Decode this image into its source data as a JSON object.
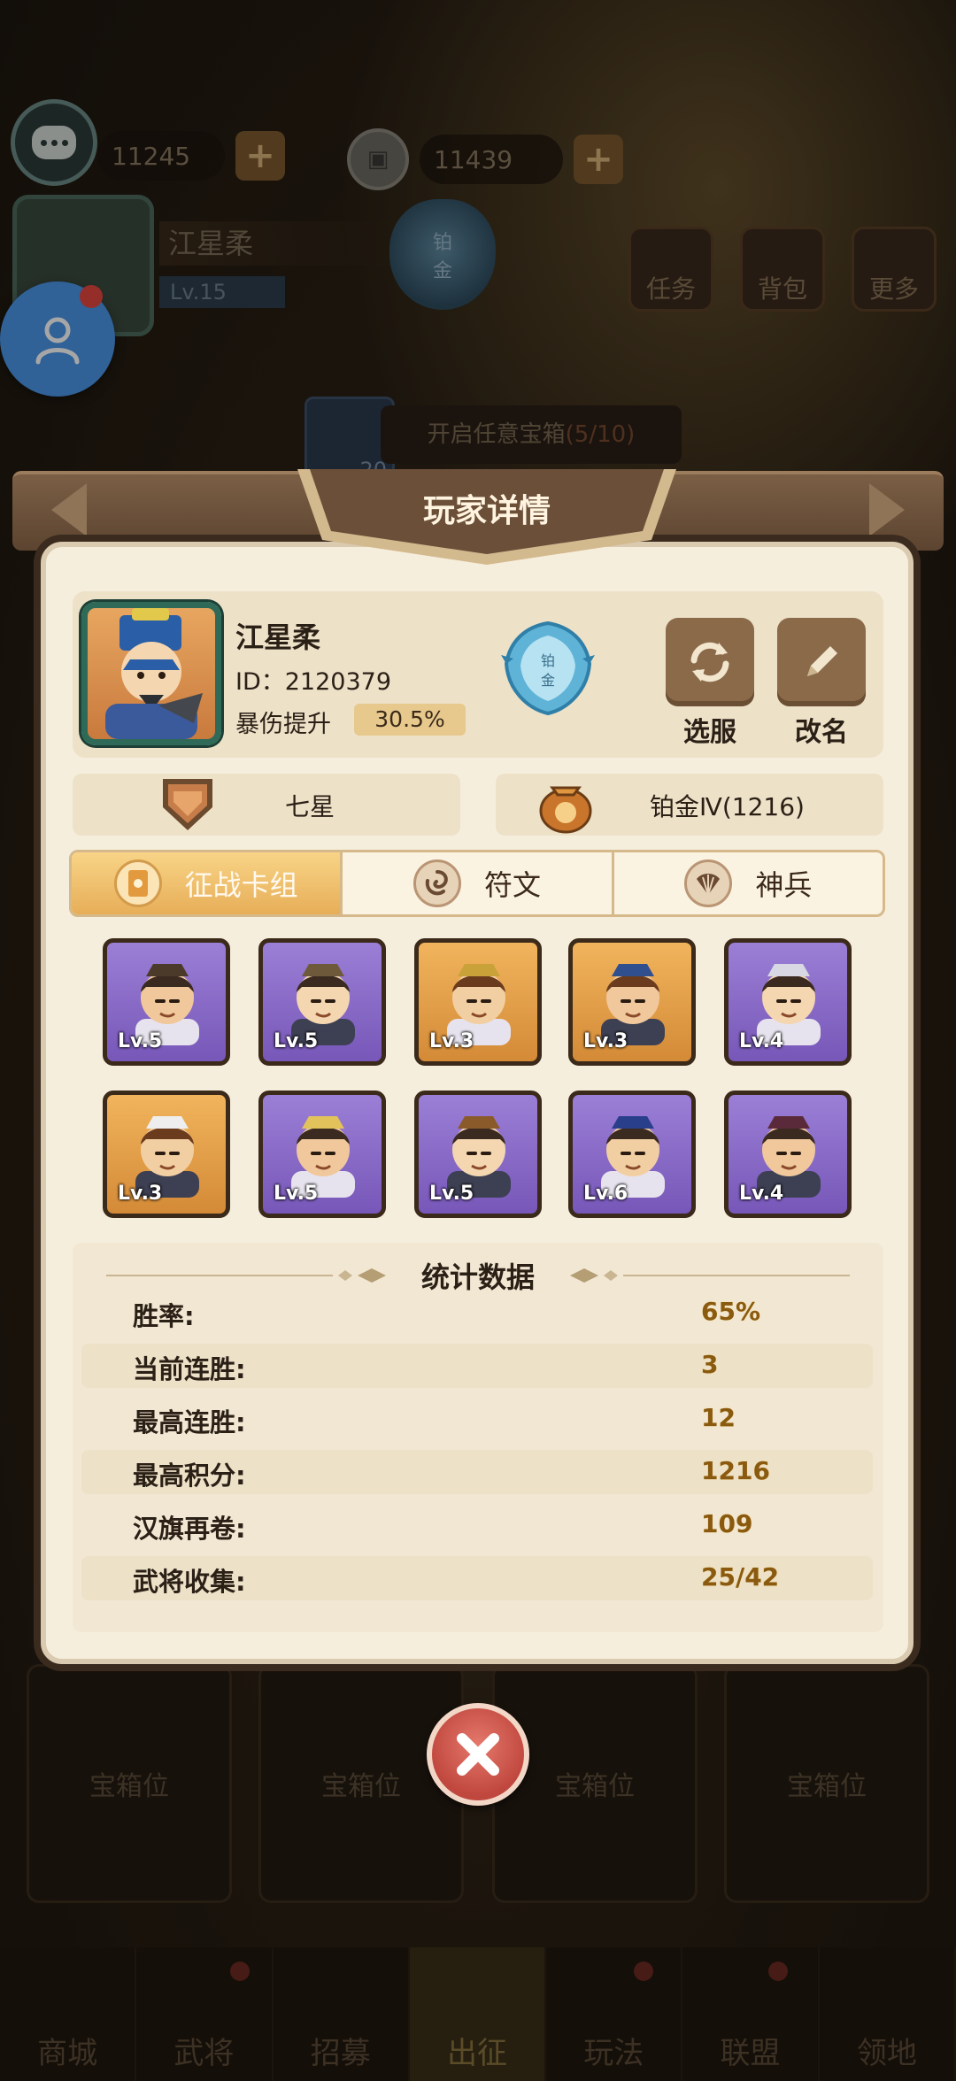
{
  "top_bar": {
    "currency1": "11245",
    "currency2": "11439"
  },
  "background": {
    "player_name": "江星柔",
    "player_level": "Lv.15",
    "rank_badge_chars": [
      "铂",
      "金"
    ],
    "menu": [
      "任务",
      "背包",
      "更多"
    ],
    "chest_count": "20",
    "chest_task": "开启任意宝箱",
    "chest_progress": "(5/10)",
    "chest_slots": [
      "宝箱位",
      "宝箱位",
      "宝箱位",
      "宝箱位"
    ],
    "bottom_nav": [
      "商城",
      "武将",
      "招募",
      "出征",
      "玩法",
      "联盟",
      "领地"
    ]
  },
  "modal": {
    "title": "玩家详情",
    "player": {
      "name": "江星柔",
      "id": "ID：2120379",
      "crit_label": "暴伤提升",
      "crit_value": "30.5%",
      "rank_badge_chars": [
        "铂",
        "金"
      ]
    },
    "actions": {
      "server": "选服",
      "rename": "改名"
    },
    "tiers": {
      "star": "七星",
      "rank": "铂金Ⅳ(1216)"
    },
    "tabs": [
      "征战卡组",
      "符文",
      "神兵"
    ],
    "active_tab": 0,
    "deck": [
      {
        "level": "Lv.5",
        "rarity": "purple"
      },
      {
        "level": "Lv.5",
        "rarity": "purple"
      },
      {
        "level": "Lv.3",
        "rarity": "gold"
      },
      {
        "level": "Lv.3",
        "rarity": "gold"
      },
      {
        "level": "Lv.4",
        "rarity": "purple"
      },
      {
        "level": "Lv.3",
        "rarity": "gold"
      },
      {
        "level": "Lv.5",
        "rarity": "purple"
      },
      {
        "level": "Lv.5",
        "rarity": "purple"
      },
      {
        "level": "Lv.6",
        "rarity": "purple"
      },
      {
        "level": "Lv.4",
        "rarity": "purple"
      }
    ],
    "stats_title": "统计数据",
    "stats": [
      {
        "label": "胜率:",
        "value": "65%"
      },
      {
        "label": "当前连胜:",
        "value": "3"
      },
      {
        "label": "最高连胜:",
        "value": "12"
      },
      {
        "label": "最高积分:",
        "value": "1216"
      },
      {
        "label": "汉旗再卷:",
        "value": "109"
      },
      {
        "label": "武将收集:",
        "value": "25/42"
      }
    ]
  },
  "colors": {
    "card_purple": "#8a6cc9",
    "card_gold": "#e29d45",
    "tab_active": "#eeb660",
    "stat_value": "#8a5a10"
  }
}
